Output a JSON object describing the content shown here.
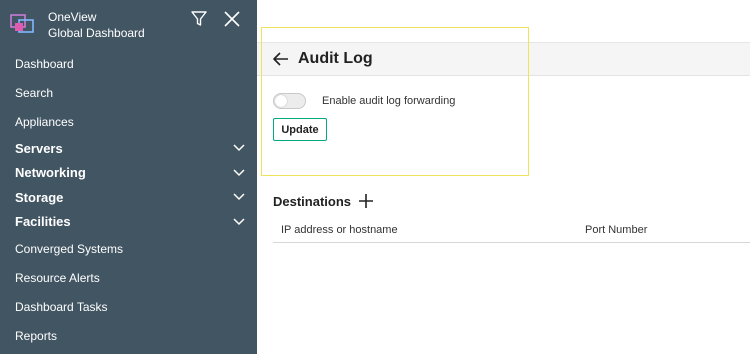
{
  "app": {
    "name": "OneView",
    "subtitle": "Global Dashboard",
    "logo_icon": "oneview-logo-icon",
    "filter_icon": "filter-icon",
    "close_icon": "close-icon"
  },
  "sidebar": {
    "items": [
      {
        "label": "Dashboard"
      },
      {
        "label": "Search"
      },
      {
        "label": "Appliances"
      }
    ],
    "groups": [
      {
        "label": "Servers",
        "icon": "chevron-down-icon"
      },
      {
        "label": "Networking",
        "icon": "chevron-down-icon"
      },
      {
        "label": "Storage",
        "icon": "chevron-down-icon"
      },
      {
        "label": "Facilities",
        "icon": "chevron-down-icon"
      }
    ],
    "more_items": [
      {
        "label": "Converged Systems"
      },
      {
        "label": "Resource Alerts"
      },
      {
        "label": "Dashboard Tasks"
      },
      {
        "label": "Reports"
      }
    ]
  },
  "page": {
    "title": "Audit Log",
    "back_icon": "arrow-left-icon",
    "toggle": {
      "label": "Enable audit log forwarding",
      "checked": false
    },
    "update_label": "Update"
  },
  "destinations": {
    "title": "Destinations",
    "add_icon": "plus-icon",
    "columns": [
      "IP address or hostname",
      "Port Number"
    ]
  },
  "colors": {
    "sidebar_bg": "#425563",
    "accent": "#01a982",
    "highlight": "#f0e35c"
  }
}
